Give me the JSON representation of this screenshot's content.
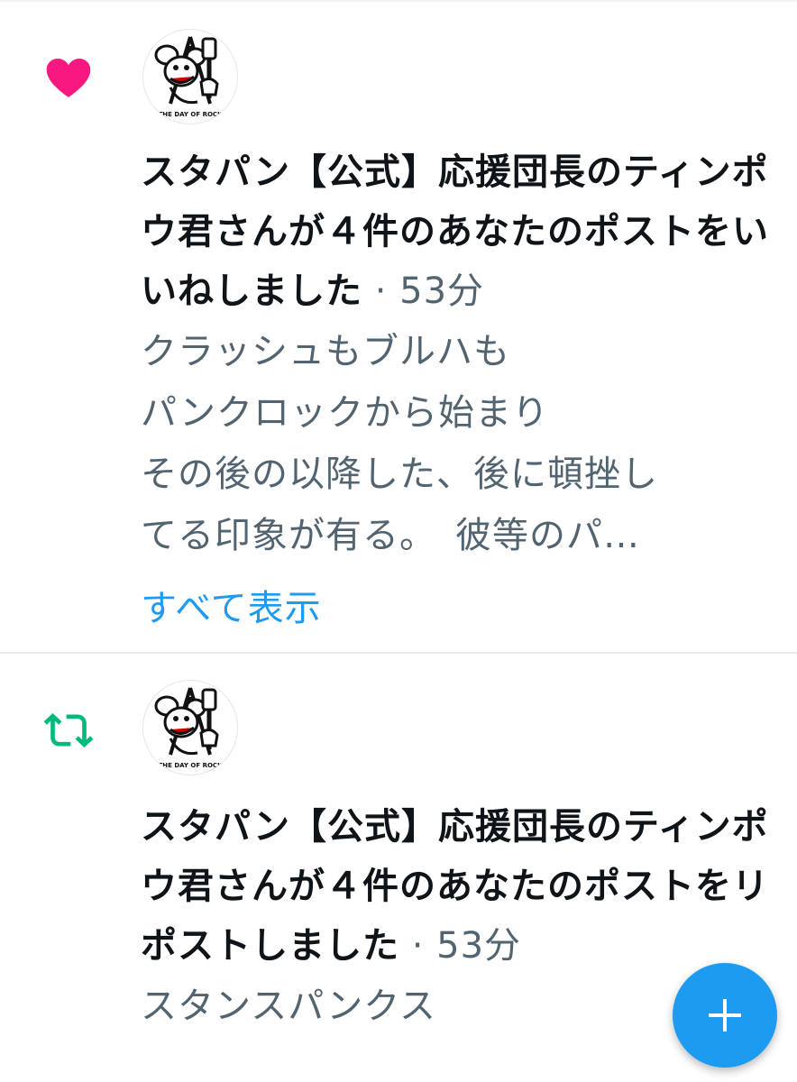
{
  "notifications": [
    {
      "type": "like",
      "icon": "heart-icon",
      "icon_color": "#f91880",
      "avatar_caption": "THE DAY OF ROCK",
      "headline": "スタパン【公式】応援団長のティンポウ君さんが４件のあなたのポストをいいねしました",
      "time": "53分",
      "text_lines": [
        "クラッシュもブルハも",
        "パンクロックから始まり",
        "その後の以降した、後に頓挫し",
        "てる印象が有る。　彼等のパ…"
      ],
      "show_all_label": "すべて表示"
    },
    {
      "type": "repost",
      "icon": "repost-icon",
      "icon_color": "#00ba7c",
      "avatar_caption": "THE DAY OF ROCK",
      "headline": "スタパン【公式】応援団長のティンポウ君さんが４件のあなたのポストをリポストしました",
      "time": "53分",
      "text_lines": [
        "スタンスパンクス"
      ]
    }
  ],
  "fab": {
    "icon": "plus-icon",
    "color": "#1d9bf0"
  }
}
